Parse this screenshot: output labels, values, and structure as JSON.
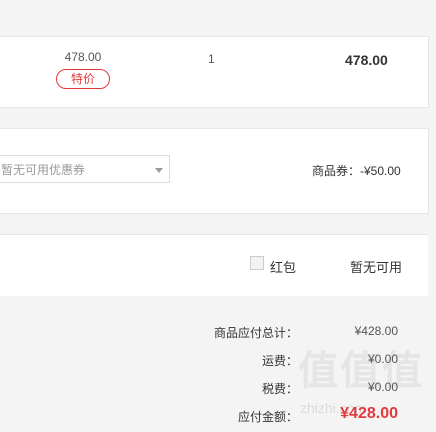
{
  "item": {
    "price": "478.00",
    "tag": "特价",
    "quantity": "1",
    "subtotal": "478.00"
  },
  "coupon": {
    "select_value": "暂无可用优惠券",
    "product_coupon": "商品券：-¥50.00"
  },
  "red_packet": {
    "label": "红包",
    "status": "暂无可用"
  },
  "summary": {
    "goods_total_label": "商品应付总计：",
    "goods_total_value": "¥428.00",
    "shipping_label": "运费：",
    "shipping_value": "¥0.00",
    "tax_label": "税费：",
    "tax_value": "¥0.00",
    "payable_label": "应付金额：",
    "payable_value": "¥428.00"
  },
  "watermark": {
    "text": "值值值",
    "domain": "zhizhi.com"
  },
  "colors": {
    "accent": "#e4393c",
    "panel_bg": "#ffffff",
    "page_bg": "#f4f4f4"
  }
}
